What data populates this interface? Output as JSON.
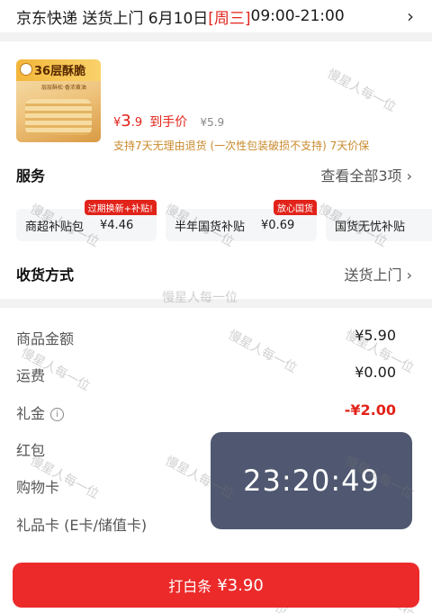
{
  "delivery": {
    "prefix": "京东快递 送货上门 6月10日 ",
    "weekday": "[周三]",
    "time": " 09:00-21:00",
    "chevron_icon": "chevron-right-icon"
  },
  "product": {
    "image_text": "36层酥脆",
    "image_subtext": "层层酥松·香浓黄油",
    "price_symbol": "¥",
    "price_int": "3",
    "price_dec": ".9",
    "price_tag": "到手价",
    "original_price": "¥5.9",
    "promise": "支持7天无理由退货 (一次性包装破损不支持)  7天价保"
  },
  "service": {
    "title": "服务",
    "view_all": "查看全部3项",
    "items": [
      {
        "name": "商超补贴包",
        "price": "¥4.46",
        "badge": "过期换新+补贴!"
      },
      {
        "name": "半年国货补贴",
        "price": "¥0.69",
        "badge": "放心国货"
      },
      {
        "name": "国货无忧补贴",
        "price": "",
        "badge": ""
      }
    ]
  },
  "receive": {
    "title": "收货方式",
    "value": "送货上门"
  },
  "fees": {
    "goods_label": "商品金额",
    "goods_value": "¥5.90",
    "shipping_label": "运费",
    "shipping_value": "¥0.00",
    "gift_label": "礼金",
    "gift_value": "-¥2.00",
    "redpacket_label": "红包",
    "shopping_card_label": "购物卡",
    "gift_card_label": "礼品卡 (E卡/储值卡)"
  },
  "overlay": {
    "clock": "23:20:49"
  },
  "pay_button": {
    "label": "打白条",
    "amount": "¥3.90"
  },
  "watermark": "慢星人每一位",
  "colors": {
    "accent": "#e2231a",
    "promise": "#c98a2c",
    "clock_bg": "#4f5870"
  }
}
